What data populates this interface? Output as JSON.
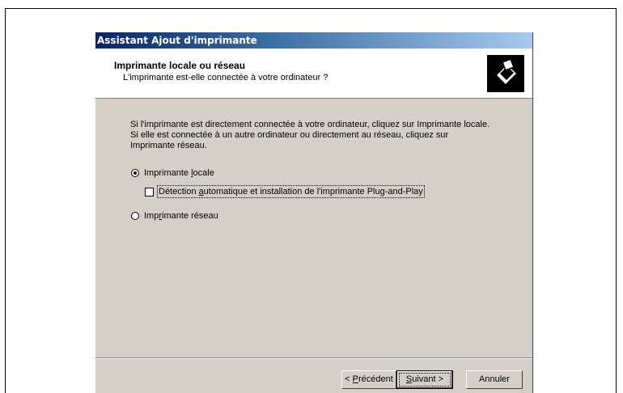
{
  "window": {
    "title": "Assistant Ajout d'imprimante"
  },
  "header": {
    "title": "Imprimante locale ou réseau",
    "subtitle": "L'imprimante est-elle connectée à votre ordinateur ?",
    "icon": "printer-icon"
  },
  "body": {
    "lines": [
      "Si l'imprimante est directement connectée à votre ordinateur, cliquez sur Imprimante locale.",
      "Si elle est connectée à un autre ordinateur ou directement au réseau, cliquez sur",
      "Imprimante réseau."
    ]
  },
  "options": {
    "local": {
      "label_pre": "Imprimante ",
      "label_accel": "l",
      "label_post": "ocale",
      "selected": true
    },
    "autodetect": {
      "label_pre": "Détection ",
      "label_accel": "a",
      "label_post": "utomatique et installation de l'imprimante Plug-and-Play",
      "checked": false
    },
    "network": {
      "label_pre": "Imp",
      "label_accel": "r",
      "label_post": "imante réseau",
      "selected": false
    }
  },
  "buttons": {
    "back": {
      "pre": "< ",
      "accel": "P",
      "post": "récédent"
    },
    "next": {
      "pre": "",
      "accel": "S",
      "post": "uivant >"
    },
    "cancel": {
      "label": "Annuler"
    }
  }
}
